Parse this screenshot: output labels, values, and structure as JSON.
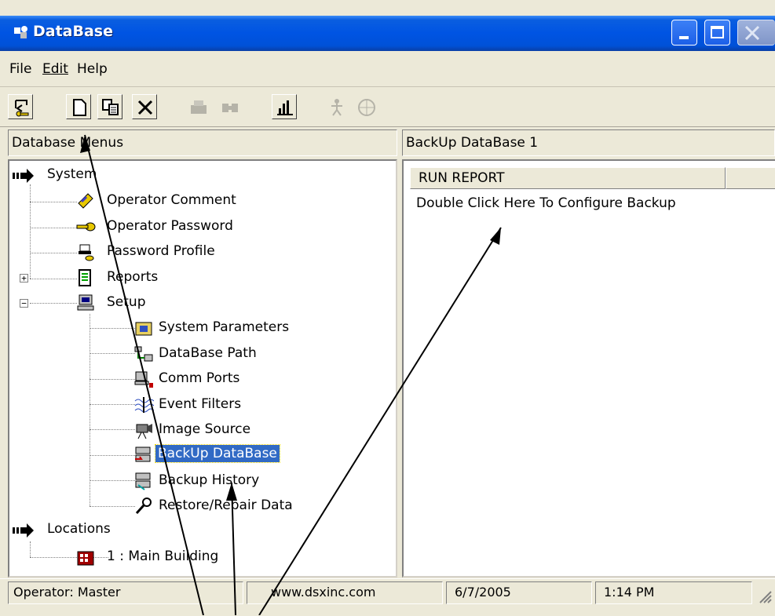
{
  "window": {
    "title": "DataBase"
  },
  "menu": [
    "File",
    "Edit",
    "Help"
  ],
  "toolbar": {
    "buttons": [
      "exit-icon",
      "new-icon",
      "copy-icon",
      "delete-icon",
      "print-icon",
      "preview-icon",
      "graph-icon",
      "person-icon",
      "globe-icon"
    ]
  },
  "left_pane": {
    "header": "Database Menus",
    "tree": {
      "system": {
        "label": "System",
        "children": [
          "Operator Comment",
          "Operator Password",
          "Password Profile",
          "Reports",
          "Setup"
        ]
      },
      "setup_children": [
        "System Parameters",
        "DataBase Path",
        "Comm Ports",
        "Event Filters",
        "Image Source",
        "BackUp DataBase",
        "Backup History",
        "Restore/Repair Data"
      ],
      "locations": {
        "label": "Locations",
        "children": [
          "1 : Main Building"
        ]
      },
      "selected": "BackUp DataBase"
    }
  },
  "right_pane": {
    "header": "BackUp DataBase  1",
    "columns": [
      "RUN REPORT",
      ""
    ],
    "rows": [
      "Double Click Here To Configure Backup"
    ]
  },
  "statusbar": {
    "operator": "Operator:  Master",
    "website": "www.dsxinc.com",
    "date": "6/7/2005",
    "time": "1:14 PM"
  },
  "colors": {
    "title_bar": "#0054e3",
    "selection": "#316ac5",
    "face": "#ece9d8"
  }
}
